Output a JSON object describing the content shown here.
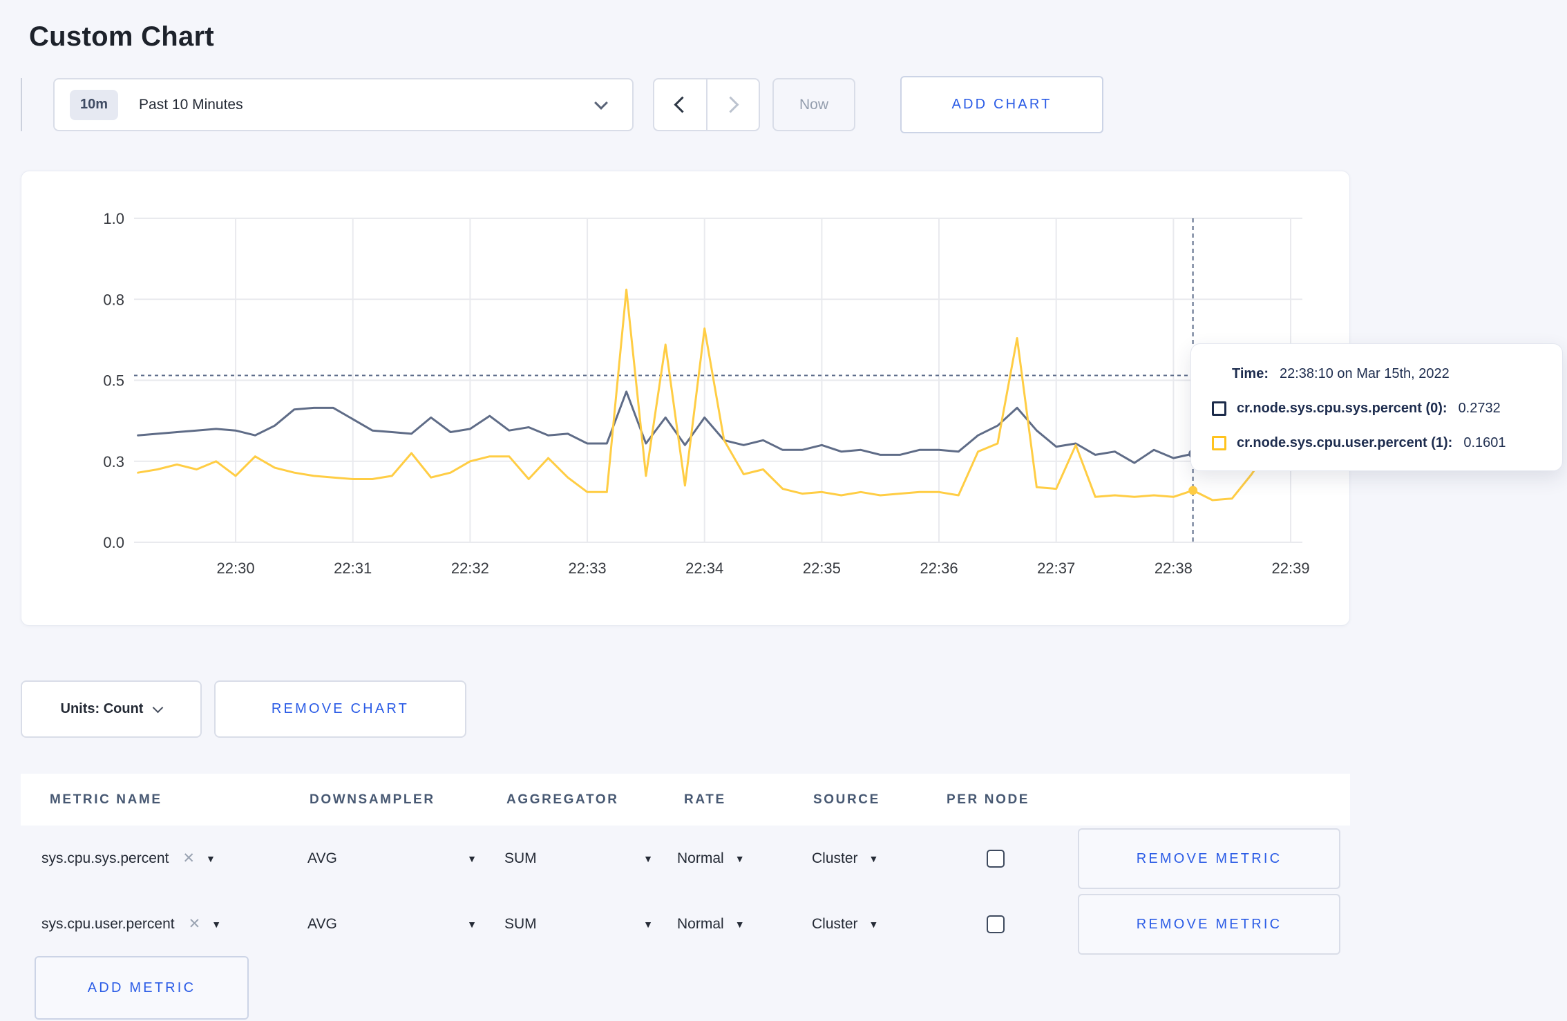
{
  "page": {
    "title": "Custom Chart"
  },
  "colors": {
    "accent_blue": "#2b5ce6",
    "page_background": "#f5f6fb",
    "gridline": "#e9eaee",
    "crosshair": "#5a6a88",
    "axis_text": "#36393f"
  },
  "icons": {
    "dropdown_arrow": "▼",
    "remove_x": "✕"
  },
  "toolbar": {
    "timeframe_badge": "10m",
    "timeframe_label": "Past 10 Minutes",
    "now_label": "Now",
    "add_chart_label": "ADD CHART"
  },
  "tooltip": {
    "time_label": "Time:",
    "time_value": "22:38:10 on Mar 15th, 2022",
    "series": [
      {
        "label": "cr.node.sys.cpu.sys.percent (0):",
        "value": "0.2732",
        "color": "#1c2b4a"
      },
      {
        "label": "cr.node.sys.cpu.user.percent (1):",
        "value": "0.1601",
        "color": "#ffc31e"
      }
    ]
  },
  "chart_footer": {
    "units_label": "Units: Count",
    "remove_chart_label": "REMOVE CHART",
    "add_metric_label": "ADD METRIC"
  },
  "metrics_table": {
    "headers": [
      "METRIC NAME",
      "DOWNSAMPLER",
      "AGGREGATOR",
      "RATE",
      "SOURCE",
      "PER NODE"
    ],
    "rows": [
      {
        "metric": "sys.cpu.sys.percent",
        "downsampler": "AVG",
        "aggregator": "SUM",
        "rate": "Normal",
        "source": "Cluster",
        "per_node_checked": false,
        "remove_label": "REMOVE METRIC"
      },
      {
        "metric": "sys.cpu.user.percent",
        "downsampler": "AVG",
        "aggregator": "SUM",
        "rate": "Normal",
        "source": "Cluster",
        "per_node_checked": false,
        "remove_label": "REMOVE METRIC"
      }
    ]
  },
  "chart_data": {
    "type": "line",
    "title": "",
    "xlabel": "",
    "ylabel": "",
    "x_unit": "seconds since 22:29:08",
    "x_domain": [
      0,
      598
    ],
    "ylim": [
      0,
      1
    ],
    "grid": true,
    "legend_position": "tooltip-only",
    "y_ticks": [
      {
        "v": 0.0,
        "label": "0.0"
      },
      {
        "v": 0.25,
        "label": "0.3"
      },
      {
        "v": 0.5,
        "label": "0.5"
      },
      {
        "v": 0.75,
        "label": "0.8"
      },
      {
        "v": 1.0,
        "label": "1.0"
      }
    ],
    "x_ticks": [
      {
        "t": 52,
        "label": "22:30"
      },
      {
        "t": 112,
        "label": "22:31"
      },
      {
        "t": 172,
        "label": "22:32"
      },
      {
        "t": 232,
        "label": "22:33"
      },
      {
        "t": 292,
        "label": "22:34"
      },
      {
        "t": 352,
        "label": "22:35"
      },
      {
        "t": 412,
        "label": "22:36"
      },
      {
        "t": 472,
        "label": "22:37"
      },
      {
        "t": 532,
        "label": "22:38"
      },
      {
        "t": 592,
        "label": "22:39"
      }
    ],
    "series": [
      {
        "name": "cr.node.sys.cpu.sys.percent",
        "color": "#5f6c87",
        "points": [
          [
            2,
            0.33
          ],
          [
            12,
            0.335
          ],
          [
            22,
            0.34
          ],
          [
            32,
            0.345
          ],
          [
            42,
            0.35
          ],
          [
            52,
            0.345
          ],
          [
            62,
            0.33
          ],
          [
            72,
            0.36
          ],
          [
            82,
            0.41
          ],
          [
            92,
            0.415
          ],
          [
            102,
            0.415
          ],
          [
            112,
            0.38
          ],
          [
            122,
            0.345
          ],
          [
            132,
            0.34
          ],
          [
            142,
            0.335
          ],
          [
            152,
            0.385
          ],
          [
            162,
            0.34
          ],
          [
            172,
            0.35
          ],
          [
            182,
            0.39
          ],
          [
            192,
            0.345
          ],
          [
            202,
            0.355
          ],
          [
            212,
            0.33
          ],
          [
            222,
            0.335
          ],
          [
            232,
            0.305
          ],
          [
            242,
            0.305
          ],
          [
            252,
            0.465
          ],
          [
            262,
            0.305
          ],
          [
            272,
            0.385
          ],
          [
            282,
            0.3
          ],
          [
            292,
            0.385
          ],
          [
            302,
            0.315
          ],
          [
            312,
            0.3
          ],
          [
            322,
            0.315
          ],
          [
            332,
            0.285
          ],
          [
            342,
            0.285
          ],
          [
            352,
            0.3
          ],
          [
            362,
            0.28
          ],
          [
            372,
            0.285
          ],
          [
            382,
            0.27
          ],
          [
            392,
            0.27
          ],
          [
            402,
            0.285
          ],
          [
            412,
            0.285
          ],
          [
            422,
            0.28
          ],
          [
            432,
            0.33
          ],
          [
            442,
            0.36
          ],
          [
            452,
            0.415
          ],
          [
            462,
            0.345
          ],
          [
            472,
            0.295
          ],
          [
            482,
            0.305
          ],
          [
            492,
            0.27
          ],
          [
            502,
            0.28
          ],
          [
            512,
            0.245
          ],
          [
            522,
            0.285
          ],
          [
            532,
            0.26
          ],
          [
            542,
            0.2732
          ],
          [
            552,
            0.29
          ],
          [
            562,
            0.3
          ],
          [
            572,
            0.295
          ],
          [
            582,
            0.305
          ],
          [
            592,
            0.3
          ],
          [
            602,
            0.295
          ]
        ]
      },
      {
        "name": "cr.node.sys.cpu.user.percent",
        "color": "#ffcd44",
        "points": [
          [
            2,
            0.215
          ],
          [
            12,
            0.225
          ],
          [
            22,
            0.24
          ],
          [
            32,
            0.225
          ],
          [
            42,
            0.25
          ],
          [
            52,
            0.205
          ],
          [
            62,
            0.265
          ],
          [
            72,
            0.23
          ],
          [
            82,
            0.215
          ],
          [
            92,
            0.205
          ],
          [
            102,
            0.2
          ],
          [
            112,
            0.195
          ],
          [
            122,
            0.195
          ],
          [
            132,
            0.205
          ],
          [
            142,
            0.275
          ],
          [
            152,
            0.2
          ],
          [
            162,
            0.215
          ],
          [
            172,
            0.25
          ],
          [
            182,
            0.265
          ],
          [
            192,
            0.265
          ],
          [
            202,
            0.195
          ],
          [
            212,
            0.26
          ],
          [
            222,
            0.2
          ],
          [
            232,
            0.155
          ],
          [
            242,
            0.155
          ],
          [
            252,
            0.78
          ],
          [
            262,
            0.205
          ],
          [
            272,
            0.61
          ],
          [
            282,
            0.175
          ],
          [
            292,
            0.66
          ],
          [
            302,
            0.315
          ],
          [
            312,
            0.21
          ],
          [
            322,
            0.225
          ],
          [
            332,
            0.165
          ],
          [
            342,
            0.15
          ],
          [
            352,
            0.155
          ],
          [
            362,
            0.145
          ],
          [
            372,
            0.155
          ],
          [
            382,
            0.145
          ],
          [
            392,
            0.15
          ],
          [
            402,
            0.155
          ],
          [
            412,
            0.155
          ],
          [
            422,
            0.145
          ],
          [
            432,
            0.28
          ],
          [
            442,
            0.305
          ],
          [
            452,
            0.63
          ],
          [
            462,
            0.17
          ],
          [
            472,
            0.165
          ],
          [
            482,
            0.3
          ],
          [
            492,
            0.14
          ],
          [
            502,
            0.145
          ],
          [
            512,
            0.14
          ],
          [
            522,
            0.145
          ],
          [
            532,
            0.14
          ],
          [
            542,
            0.1601
          ],
          [
            552,
            0.13
          ],
          [
            562,
            0.135
          ],
          [
            572,
            0.21
          ],
          [
            582,
            0.3
          ],
          [
            592,
            0.27
          ],
          [
            602,
            0.235
          ]
        ]
      }
    ],
    "hover": {
      "t": 542,
      "time": "22:38:10",
      "hline_value": 0.515,
      "points": [
        {
          "series": 0,
          "v": 0.2732
        },
        {
          "series": 1,
          "v": 0.1601
        }
      ]
    }
  }
}
